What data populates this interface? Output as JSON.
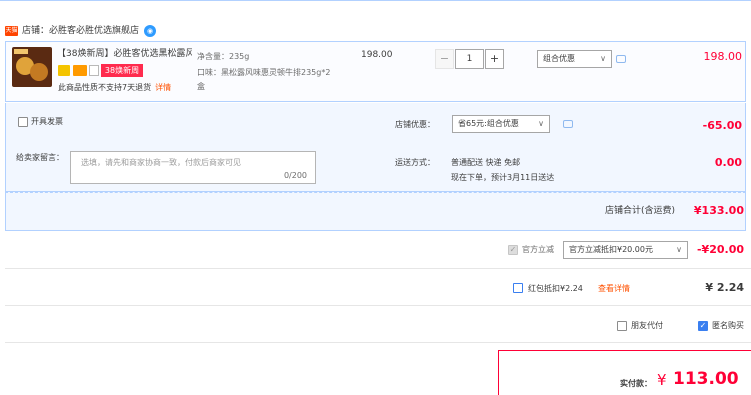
{
  "store": {
    "tag": "天猫",
    "label": "店铺：必胜客必胜优选旗舰店",
    "wangwang_icon": "wangwang-chat-icon"
  },
  "item": {
    "title": "【38焕新周】必胜客优选黑松露风味...",
    "promo_badge": "38焕新周",
    "return_notice": "此商品性质不支持7天退货",
    "return_link": "详情",
    "spec_weight": "净含量：235g",
    "spec_flavor": "口味：黑松露风味惠灵顿牛排235g*2盒",
    "unit_price": "198.00",
    "quantity": "1",
    "qty_minus": "−",
    "qty_plus": "+",
    "discount_select": "组合优惠",
    "subtotal": "198.00"
  },
  "options": {
    "invoice_label": "开具发票",
    "store_discount_label": "店铺优惠：",
    "store_discount_select": "省65元:组合优惠",
    "store_discount_amount": "-65.00",
    "message_label": "给卖家留言：",
    "message_placeholder": "选填，请先和商家协商一致，付款后商家可见",
    "message_count": "0/200",
    "shipping_label": "运送方式：",
    "shipping_method": "普通配送 快递 免邮",
    "shipping_eta": "现在下单，预计3月11日送达",
    "shipping_amount": "0.00"
  },
  "total": {
    "label": "店铺合计(含运费)",
    "amount": "¥133.00"
  },
  "official_discount": {
    "label": "官方立减",
    "select": "官方立减抵扣¥20.00元",
    "amount": "-¥20.00"
  },
  "red_packet": {
    "label": "红包抵扣¥2.24",
    "link": "查看详情",
    "amount": "¥ 2.24"
  },
  "extras": {
    "friend_pay": "朋友代付",
    "anonymous": "匿名购买"
  },
  "payment": {
    "label": "实付款：",
    "currency": "¥",
    "amount": "113.00"
  },
  "colors": {
    "accent_red": "#ff0036",
    "border_blue": "#b2d1ff",
    "panel_bg": "#f2f7ff"
  }
}
